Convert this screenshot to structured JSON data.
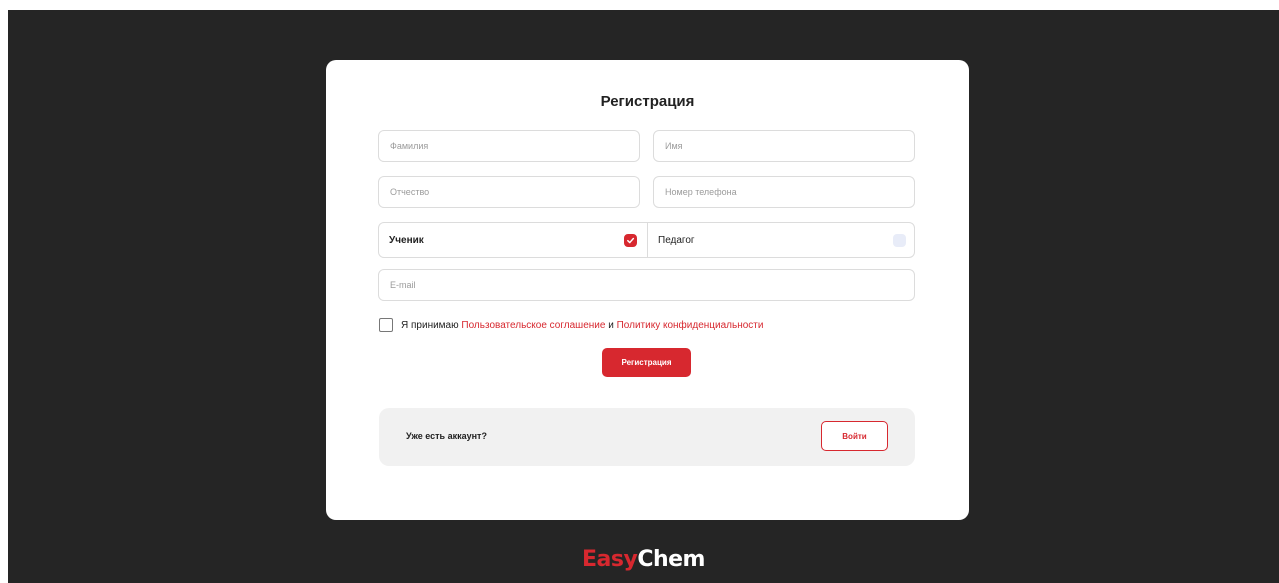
{
  "form": {
    "title": "Регистрация",
    "fields": {
      "last_name": {
        "placeholder": "Фамилия",
        "value": ""
      },
      "first_name": {
        "placeholder": "Имя",
        "value": ""
      },
      "middle_name": {
        "placeholder": "Отчество",
        "value": ""
      },
      "phone": {
        "placeholder": "Номер телефона",
        "value": ""
      },
      "email": {
        "placeholder": "E-mail",
        "value": ""
      }
    },
    "roles": [
      {
        "label": "Ученик",
        "selected": true
      },
      {
        "label": "Педагог",
        "selected": false
      }
    ],
    "agreement": {
      "prefix": "Я принимаю ",
      "terms_link": "Пользовательское соглашение",
      "joiner": " и ",
      "privacy_link": "Политику конфиденциальности",
      "checked": false
    },
    "submit_label": "Регистрация"
  },
  "login_panel": {
    "text": "Уже есть аккаунт?",
    "button_label": "Войти"
  },
  "logo": {
    "part1": "Easy",
    "part2": "Chem"
  },
  "colors": {
    "accent": "#d7282f",
    "background": "#252525",
    "card": "#ffffff",
    "panel": "#f1f1f1"
  },
  "icons": {
    "selected_role": "check-icon"
  }
}
